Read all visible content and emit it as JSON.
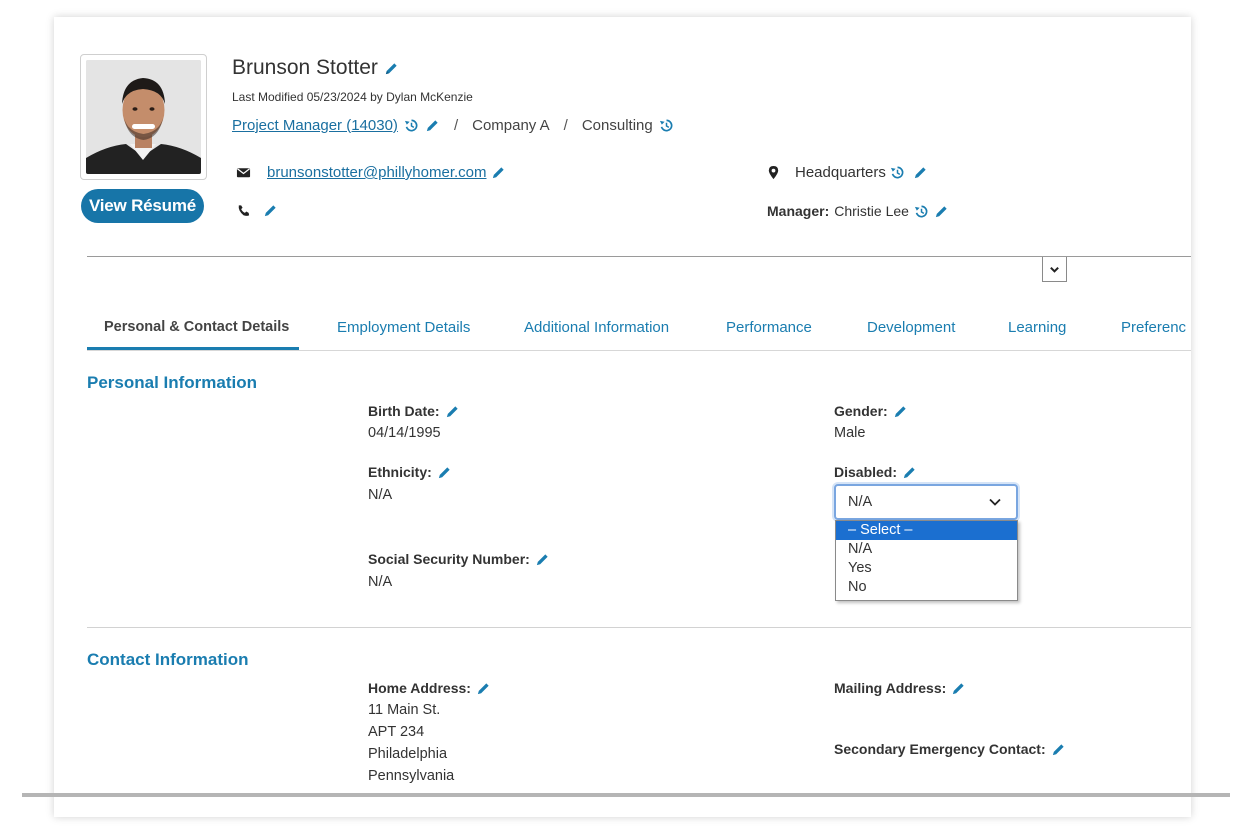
{
  "profile": {
    "name": "Brunson Stotter",
    "last_modified": "Last Modified 05/23/2024 by Dylan McKenzie",
    "job_title": "Project Manager (14030)",
    "company": "Company A",
    "department": "Consulting",
    "email": "brunsonstotter@phillyhomer.com",
    "location": "Headquarters",
    "manager_label": "Manager:",
    "manager": "Christie Lee",
    "resume_button": "View Résumé"
  },
  "tabs": [
    {
      "label": "Personal & Contact Details",
      "active": true
    },
    {
      "label": "Employment Details"
    },
    {
      "label": "Additional Information"
    },
    {
      "label": "Performance"
    },
    {
      "label": "Development"
    },
    {
      "label": "Learning"
    },
    {
      "label": "Preferenc"
    }
  ],
  "personal": {
    "title": "Personal Information",
    "birth_date_label": "Birth Date:",
    "birth_date": "04/14/1995",
    "gender_label": "Gender:",
    "gender": "Male",
    "ethnicity_label": "Ethnicity:",
    "ethnicity": "N/A",
    "disabled_label": "Disabled:",
    "disabled_value": "N/A",
    "ssn_label": "Social Security Number:",
    "ssn": "N/A"
  },
  "disabled_dropdown": {
    "options": [
      "– Select –",
      "N/A",
      "Yes",
      "No"
    ],
    "highlighted": "– Select –"
  },
  "contact": {
    "title": "Contact Information",
    "home_address_label": "Home Address:",
    "home_address": [
      "11 Main St.",
      "APT 234",
      "Philadelphia",
      "Pennsylvania"
    ],
    "mailing_address_label": "Mailing Address:",
    "secondary_contact_label": "Secondary Emergency Contact:"
  },
  "colors": {
    "accent": "#1a7db0",
    "button": "#1775a8",
    "highlight": "#1b6fd0"
  }
}
